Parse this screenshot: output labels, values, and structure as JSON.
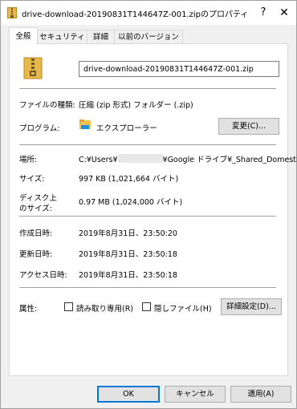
{
  "window": {
    "title": "drive-download-20190831T144647Z-001.zipのプロパティ",
    "help_glyph": "?",
    "close_glyph": "✕"
  },
  "tabs": [
    "全般",
    "セキュリティ",
    "詳細",
    "以前のバージョン"
  ],
  "general": {
    "file_name": "drive-download-20190831T144647Z-001.zip",
    "file_type_label": "ファイルの種類:",
    "file_type_value": "圧縮 (zip 形式) フォルダー (.zip)",
    "program_label": "プログラム:",
    "program_value": "エクスプローラー",
    "change_button": "変更(C)...",
    "location_label": "場所:",
    "location_prefix": "C:¥Users¥",
    "location_suffix": "¥Google ドライブ¥_Shared_Domestic",
    "size_label": "サイズ:",
    "size_value": "997 KB (1,021,664 バイト)",
    "disk_size_label_1": "ディスク上",
    "disk_size_label_2": "のサイズ:",
    "disk_size_value": "0.97 MB (1,024,000 バイト)",
    "created_label": "作成日時:",
    "created_value": "2019年8月31日、23:50:20",
    "modified_label": "更新日時:",
    "modified_value": "2019年8月31日、23:50:18",
    "accessed_label": "アクセス日時:",
    "accessed_value": "2019年8月31日、23:50:18",
    "attributes_label": "属性:",
    "readonly_label": "読み取り専用(R)",
    "hidden_label": "隠しファイル(H)",
    "advanced_button": "詳細設定(D)...",
    "readonly_checked": false,
    "hidden_checked": false
  },
  "footer": {
    "ok": "OK",
    "cancel": "キャンセル",
    "apply": "適用(A)"
  },
  "colors": {
    "zip_folder": "#e8b84a",
    "zip_stripe": "#6b5a2a",
    "explorer_folder": "#f2c24e",
    "explorer_blue": "#1e8fd6",
    "focus_border": "#0078d7"
  }
}
